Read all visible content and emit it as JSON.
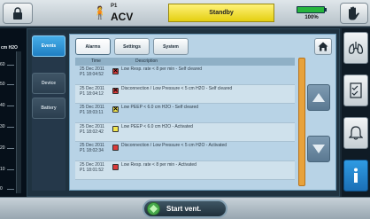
{
  "header": {
    "patient_label": "P1",
    "mode": "ACV",
    "status": "Standby",
    "battery_percent": "100%",
    "battery_level": 1.0
  },
  "pressure": {
    "unit": "cm H2O",
    "ticks": [
      "60",
      "50",
      "40",
      "30",
      "20",
      "10",
      "0"
    ]
  },
  "side_tabs": [
    "Events",
    "Device",
    "Battery"
  ],
  "top_tabs": [
    "Alarms",
    "Settings",
    "System"
  ],
  "log": {
    "headers": [
      "Time",
      "Description"
    ],
    "rows": [
      {
        "datetime": "25 Dec 2011\nP1 18:04:52",
        "marker": "cleared",
        "desc": "Low Resp. rate < 8 per min - Self cleared"
      },
      {
        "datetime": "25 Dec 2011\nP1 18:04:12",
        "marker": "cleared",
        "desc": "Disconnection / Low Pressure < 5 cm H2O - Self cleared"
      },
      {
        "datetime": "25 Dec 2011\nP1 18:03:11",
        "marker": "cleared-warning",
        "desc": "Low PEEP < 6.0 cm H2O - Self cleared"
      },
      {
        "datetime": "25 Dec 2011\nP1 18:02:42",
        "marker": "warning",
        "desc": "Low PEEP < 6.0 cm H2O - Activated"
      },
      {
        "datetime": "25 Dec 2011\nP1 18:02:34",
        "marker": "alarm",
        "desc": "Disconnection / Low Pressure < 5 cm H2O - Activated"
      },
      {
        "datetime": "25 Dec 2011\nP1 18:01:52",
        "marker": "alarm",
        "desc": "Low Resp. rate < 8 per min - Activated"
      }
    ]
  },
  "marker_colors": {
    "alarm": "#d93a3a",
    "warning": "#f2e64f",
    "cleared": "#d93a3a",
    "cleared-warning": "#f2e64f"
  },
  "right_icons": [
    "lungs-icon",
    "checklist-icon",
    "bell-icon",
    "info-icon"
  ],
  "bottom": {
    "start_label": "Start vent."
  }
}
